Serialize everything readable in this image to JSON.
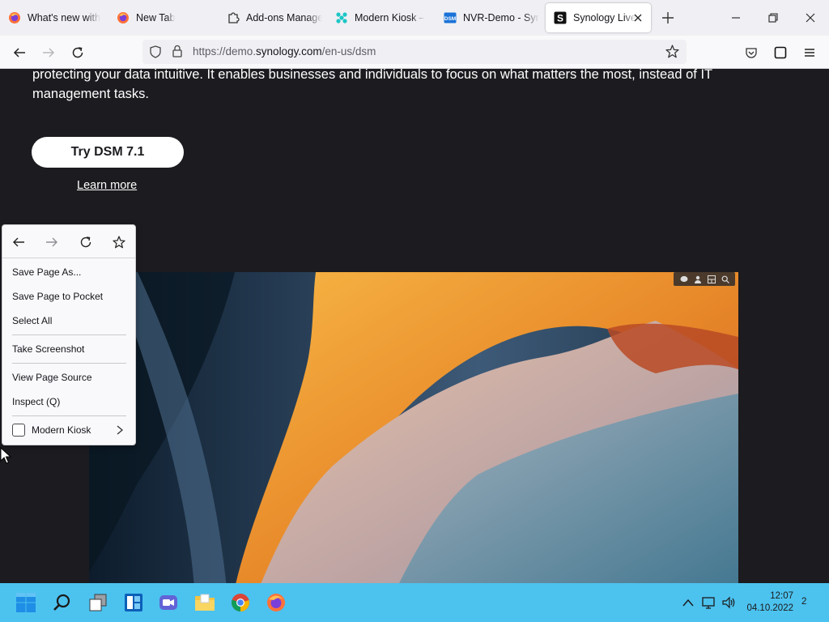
{
  "browser": {
    "tabs": [
      {
        "title": "What's new with",
        "icon": "firefox-icon"
      },
      {
        "title": "New Tab",
        "icon": "firefox-icon"
      },
      {
        "title": "Add-ons Manage",
        "icon": "puzzle-piece-icon"
      },
      {
        "title": "Modern Kiosk – ",
        "icon": "kiosk-icon"
      },
      {
        "title": "NVR-Demo - Syn",
        "icon": "dsm-icon"
      },
      {
        "title": "Synology Live",
        "icon": "synology-s-icon",
        "active": true
      }
    ],
    "url": {
      "prefix": "https://demo.",
      "domain": "synology.com",
      "path": "/en-us/dsm"
    }
  },
  "page": {
    "intro_line1": "protecting your data intuitive. It enables businesses and individuals to focus on what matters the most, instead of IT",
    "intro_line2": "management tasks.",
    "cta_label": "Try DSM 7.1",
    "learn_more": "Learn more"
  },
  "context_menu": {
    "items": [
      {
        "label": "Save Page As..."
      },
      {
        "label": "Save Page to Pocket"
      },
      {
        "label": "Select All"
      },
      {
        "label": "Take Screenshot"
      },
      {
        "label": "View Page Source"
      },
      {
        "label": "Inspect (Q)"
      }
    ],
    "submenu_label": "Modern Kiosk"
  },
  "taskbar": {
    "apps": [
      "windows-start-icon",
      "search-icon",
      "task-view-icon",
      "widgets-icon",
      "teams-chat-icon",
      "file-explorer-icon",
      "chrome-icon",
      "firefox-icon"
    ],
    "time": "12:07",
    "date": "04.10.2022",
    "notification_count": "2"
  },
  "colors": {
    "page_background": "#1c1b1f",
    "taskbar": "#4cc2ef",
    "tab_strip": "#f0f0f4"
  }
}
